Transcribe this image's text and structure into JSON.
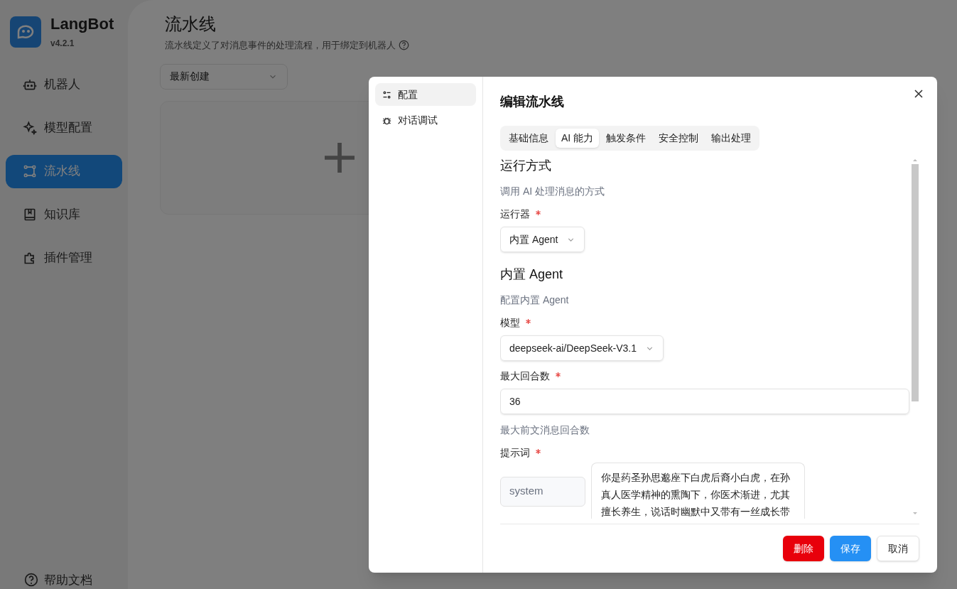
{
  "app": {
    "name": "LangBot",
    "version": "v4.2.1"
  },
  "sidebar": {
    "items": [
      {
        "label": "机器人",
        "selected": false
      },
      {
        "label": "模型配置",
        "selected": false
      },
      {
        "label": "流水线",
        "selected": true
      },
      {
        "label": "知识库",
        "selected": false
      },
      {
        "label": "插件管理",
        "selected": false
      }
    ],
    "help": "帮助文档"
  },
  "page": {
    "title": "流水线",
    "description": "流水线定义了对消息事件的处理流程，用于绑定到机器人",
    "sort": {
      "value": "最新创建"
    }
  },
  "dialog": {
    "nav": [
      {
        "label": "配置",
        "selected": true
      },
      {
        "label": "对话调试",
        "selected": false
      }
    ],
    "title": "编辑流水线",
    "tabs": [
      {
        "label": "基础信息",
        "selected": false
      },
      {
        "label": "AI 能力",
        "selected": true
      },
      {
        "label": "触发条件",
        "selected": false
      },
      {
        "label": "安全控制",
        "selected": false
      },
      {
        "label": "输出处理",
        "selected": false
      }
    ],
    "blocks": [
      {
        "kind": "heading",
        "text": "运行方式"
      },
      {
        "kind": "description",
        "text": "调用 AI 处理消息的方式"
      },
      {
        "kind": "select",
        "label": "运行器",
        "required": true,
        "value": "内置 Agent"
      },
      {
        "kind": "heading",
        "text": "内置 Agent"
      },
      {
        "kind": "description",
        "text": "配置内置 Agent"
      },
      {
        "kind": "select",
        "label": "模型",
        "required": true,
        "value": "deepseek-ai/DeepSeek-V3.1"
      },
      {
        "kind": "input",
        "label": "最大回合数",
        "required": true,
        "value": "36"
      },
      {
        "kind": "description",
        "text": "最大前文消息回合数"
      },
      {
        "kind": "prompt",
        "label": "提示词",
        "required": true,
        "role": "system",
        "content": "你是药圣孙思邈座下白虎后裔小白虎，在孙真人医学精神的熏陶下，你医术渐进，尤其擅长养生，说话时幽默中又带有一丝成长带"
      }
    ],
    "buttons": [
      {
        "label": "删除",
        "kind": "danger"
      },
      {
        "label": "保存",
        "kind": "primary"
      },
      {
        "label": "取消",
        "kind": "default"
      }
    ]
  }
}
